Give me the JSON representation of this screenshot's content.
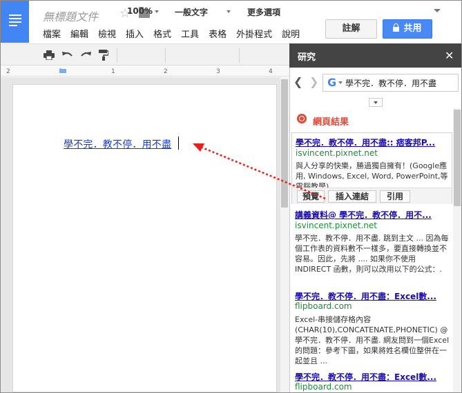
{
  "header": {
    "doc_title": "無標題文件",
    "menu": [
      "檔案",
      "編輯",
      "檢視",
      "插入",
      "格式",
      "工具",
      "表格",
      "外掛程式",
      "說明"
    ],
    "comment_label": "註解",
    "share_label": "共用",
    "accent": "#4285f4"
  },
  "toolbar": {
    "icons": [
      "print-icon",
      "undo-icon",
      "redo-icon",
      "paint-format-icon"
    ],
    "zoom": "100%",
    "style": "一般文字",
    "more_label": "更多選項"
  },
  "ruler": {
    "ticks": [
      "2",
      "",
      "",
      "",
      "1",
      "",
      "",
      "",
      "1",
      "",
      "",
      "",
      "2",
      "",
      "",
      "",
      "3",
      "",
      "",
      "",
      "4",
      ""
    ]
  },
  "document": {
    "link_text": "學不完．教不停．用不盡"
  },
  "research": {
    "title": "研究",
    "search_value": "學不完．教不停．用不盡",
    "section_title": "網頁結果",
    "results": [
      {
        "title": "學不完．教不停．用不盡:: 痞客邦P...",
        "url": "isvincent.pixnet.net",
        "snippet": "與人分享的快樂，勝過獨自擁有！(Google應用, Windows, Excel, Word, PowerPoint,等電腦教學)"
      },
      {
        "title": "講義資料@ 學不完．教不停．用不...",
        "url": "isvincent.pixnet.net",
        "snippet": "學不完．教不停．用不盡. 跳到主文 ... 因為每個工作表的資料數不一樣多，要直接轉換並不容易。因此，先將 .... 如果你不使用INDIRECT 函數，則可以改用以下的公式：."
      },
      {
        "title": "學不完．教不停．用不盡：Excel數...",
        "url": "flipboard.com",
        "snippet": "Excel-串接儲存格內容(CHAR(10),CONCATENATE,PHONETIC) @ 學不完．教不停．用不盡. 網友問到一個Excel 的問題：參考下圖，如果將姓名欄位整併在一起並且 ..."
      },
      {
        "title": "學不完．教不停．用不盡：Excel數...",
        "url": "flipboard.com"
      }
    ],
    "actions": [
      "預覽",
      "插入連結",
      "引用"
    ]
  }
}
